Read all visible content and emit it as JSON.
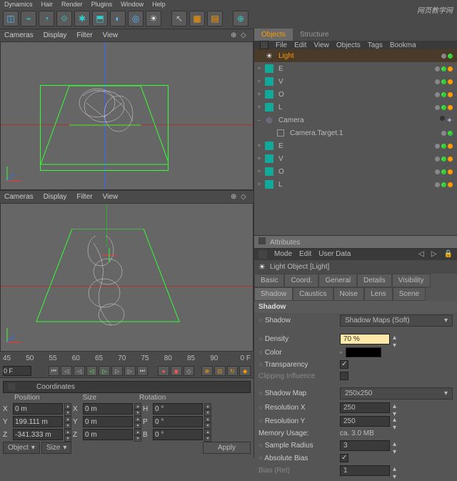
{
  "topmenu": [
    "Dynamics",
    "Hair",
    "Render",
    "Plugins",
    "Window",
    "Help"
  ],
  "viewport_menu": [
    "Cameras",
    "Display",
    "Filter",
    "View"
  ],
  "ruler": [
    "45",
    "50",
    "55",
    "60",
    "65",
    "70",
    "75",
    "80",
    "85",
    "90"
  ],
  "ruler_end": "0 F",
  "time_start": "0 F",
  "coords": {
    "title": "Coordinates",
    "headers": [
      "Position",
      "Size",
      "Rotation"
    ],
    "rows": [
      {
        "axis": "X",
        "pos": "0 m",
        "size": "0 m",
        "rot": "0 °",
        "rotlbl": "H"
      },
      {
        "axis": "Y",
        "pos": "199.111 m",
        "size": "0 m",
        "rot": "0 °",
        "rotlbl": "P"
      },
      {
        "axis": "Z",
        "pos": "-341.333 m",
        "size": "0 m",
        "rot": "0 °",
        "rotlbl": "B"
      }
    ],
    "dd1": "Object",
    "dd2": "Size",
    "apply": "Apply"
  },
  "tabs": {
    "objects": "Objects",
    "structure": "Structure"
  },
  "objmenu": [
    "File",
    "Edit",
    "View",
    "Objects",
    "Tags",
    "Bookma"
  ],
  "tree": [
    {
      "icon": "light",
      "name": "Light",
      "sel": true
    },
    {
      "icon": "cube",
      "name": "E",
      "exp": "+"
    },
    {
      "icon": "cube",
      "name": "V",
      "exp": "+"
    },
    {
      "icon": "cube",
      "name": "O",
      "exp": "+"
    },
    {
      "icon": "cube",
      "name": "L",
      "exp": "+"
    },
    {
      "icon": "cam",
      "name": "Camera",
      "camtag": true
    },
    {
      "icon": "null",
      "name": "Camera.Target.1",
      "indent": true
    },
    {
      "icon": "cube",
      "name": "E",
      "exp": "+"
    },
    {
      "icon": "cube",
      "name": "V",
      "exp": "+"
    },
    {
      "icon": "cube",
      "name": "O",
      "exp": "+"
    },
    {
      "icon": "cube",
      "name": "L",
      "exp": "+"
    }
  ],
  "attrs": {
    "title": "Attributes",
    "menu": [
      "Mode",
      "Edit",
      "User Data"
    ],
    "objtitle": "Light Object [Light]",
    "tabs1": [
      "Basic",
      "Coord.",
      "General",
      "Details",
      "Visibility",
      "Shadow"
    ],
    "tabs2": [
      "Caustics",
      "Noise",
      "Lens",
      "Scene"
    ],
    "section": "Shadow",
    "shadow_label": "Shadow",
    "shadow_type": "Shadow Maps (Soft)",
    "density_label": "Density",
    "density_val": "70 %",
    "color_label": "Color",
    "transparency_label": "Transparency",
    "clip_label": "Clipping Influence",
    "shadowmap_label": "Shadow Map",
    "shadowmap_val": "250x250",
    "resx_label": "Resolution X",
    "resx_val": "250",
    "resy_label": "Resolution Y",
    "resy_val": "250",
    "mem_label": "Memory Usage:",
    "mem_val": "ca. 3.0 MB",
    "sample_label": "Sample Radius",
    "sample_val": "3",
    "absbias_label": "Absolute Bias",
    "bias_label": "Bias (Rel)",
    "bias_val": "1"
  },
  "watermark": "网页教学网"
}
